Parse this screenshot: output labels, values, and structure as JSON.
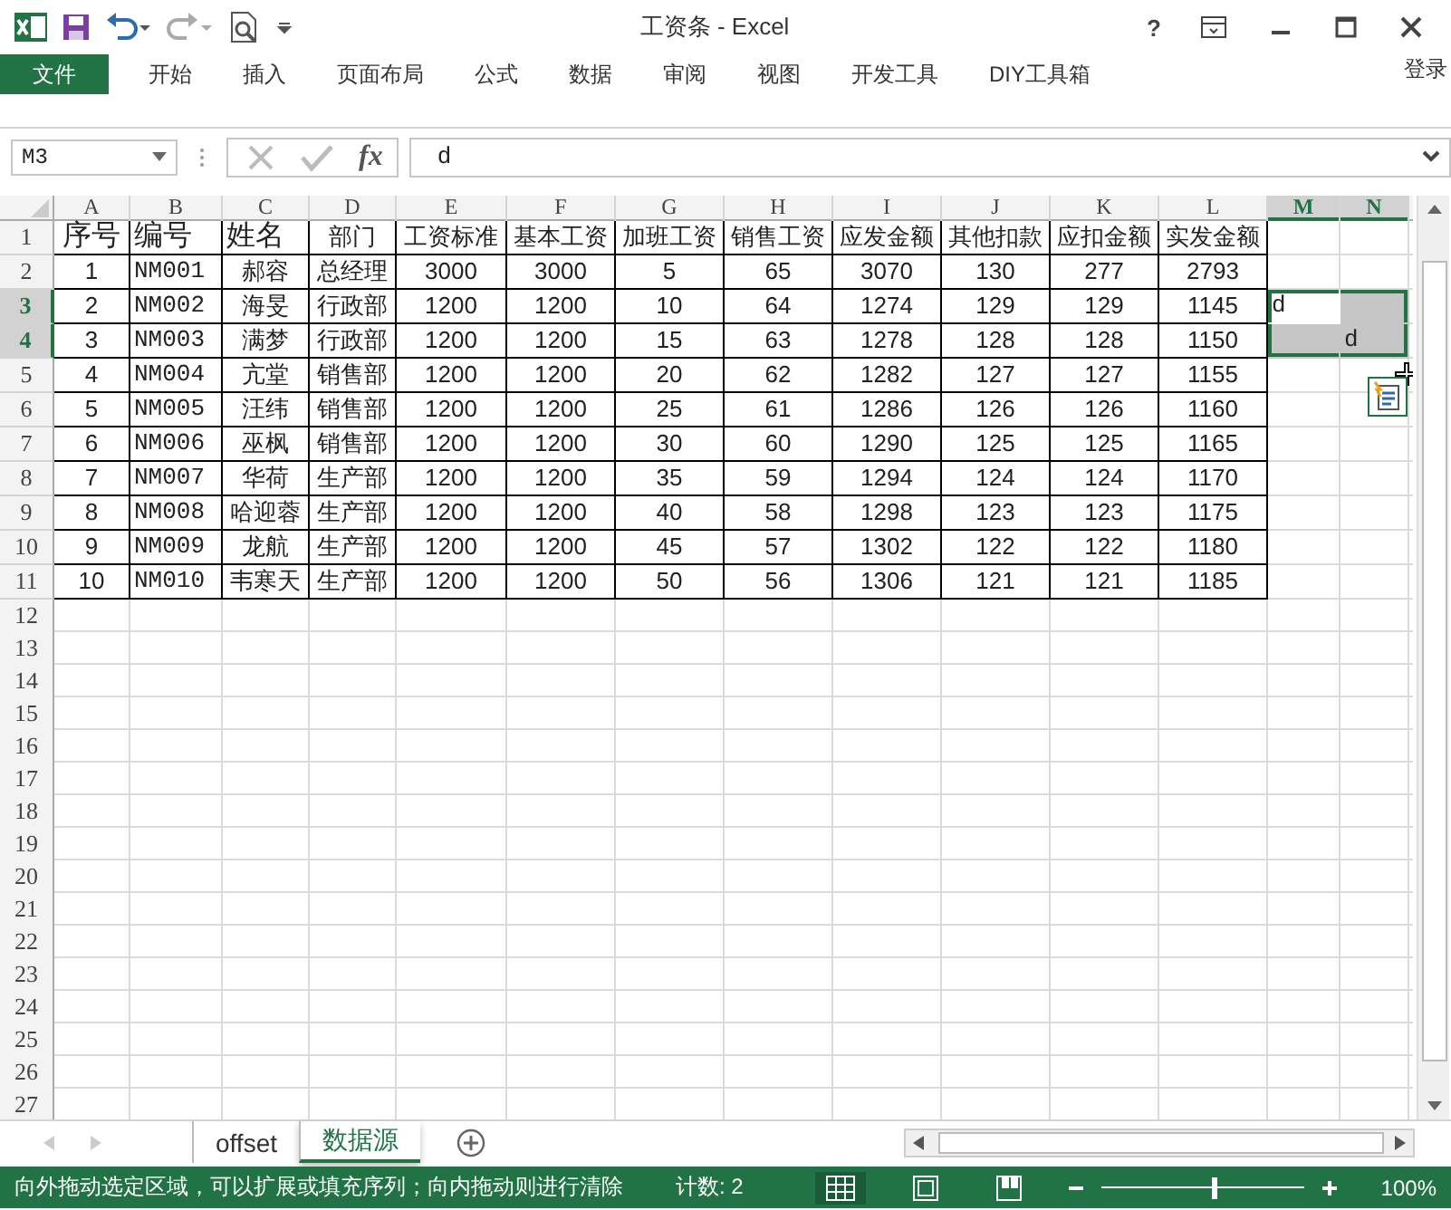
{
  "window": {
    "title": "工资条 - Excel",
    "help": "?"
  },
  "ribbon_tabs": [
    {
      "label": "文件",
      "selected": true
    },
    {
      "label": "开始",
      "selected": false
    },
    {
      "label": "插入",
      "selected": false
    },
    {
      "label": "页面布局",
      "selected": false
    },
    {
      "label": "公式",
      "selected": false
    },
    {
      "label": "数据",
      "selected": false
    },
    {
      "label": "审阅",
      "selected": false
    },
    {
      "label": "视图",
      "selected": false
    },
    {
      "label": "开发工具",
      "selected": false
    },
    {
      "label": "DIY工具箱",
      "selected": false
    }
  ],
  "sign_in": "登录",
  "formula_bar": {
    "name_box": "M3",
    "fx": "fx",
    "value": "d"
  },
  "columns": [
    {
      "label": "A",
      "selected": false
    },
    {
      "label": "B",
      "selected": false
    },
    {
      "label": "C",
      "selected": false
    },
    {
      "label": "D",
      "selected": false
    },
    {
      "label": "E",
      "selected": false
    },
    {
      "label": "F",
      "selected": false
    },
    {
      "label": "G",
      "selected": false
    },
    {
      "label": "H",
      "selected": false
    },
    {
      "label": "I",
      "selected": false
    },
    {
      "label": "J",
      "selected": false
    },
    {
      "label": "K",
      "selected": false
    },
    {
      "label": "L",
      "selected": false
    },
    {
      "label": "M",
      "selected": true
    },
    {
      "label": "N",
      "selected": true
    }
  ],
  "rows": [
    {
      "number": "1",
      "selected": false,
      "cells": [
        "序号",
        "编号",
        "姓名",
        "部门",
        "工资标准",
        "基本工资",
        "加班工资",
        "销售工资",
        "应发金额",
        "其他扣款",
        "应扣金额",
        "实发金额"
      ]
    },
    {
      "number": "2",
      "selected": false,
      "cells": [
        "1",
        "NM001",
        "郝容",
        "总经理",
        "3000",
        "3000",
        "5",
        "65",
        "3070",
        "130",
        "277",
        "2793"
      ]
    },
    {
      "number": "3",
      "selected": true,
      "cells": [
        "2",
        "NM002",
        "海旻",
        "行政部",
        "1200",
        "1200",
        "10",
        "64",
        "1274",
        "129",
        "129",
        "1145",
        "d",
        null
      ]
    },
    {
      "number": "4",
      "selected": true,
      "cells": [
        "3",
        "NM003",
        "满梦",
        "行政部",
        "1200",
        "1200",
        "15",
        "63",
        "1278",
        "128",
        "128",
        "1150",
        null,
        "d"
      ]
    },
    {
      "number": "5",
      "selected": false,
      "cells": [
        "4",
        "NM004",
        "亢堂",
        "销售部",
        "1200",
        "1200",
        "20",
        "62",
        "1282",
        "127",
        "127",
        "1155"
      ]
    },
    {
      "number": "6",
      "selected": false,
      "cells": [
        "5",
        "NM005",
        "汪纬",
        "销售部",
        "1200",
        "1200",
        "25",
        "61",
        "1286",
        "126",
        "126",
        "1160"
      ]
    },
    {
      "number": "7",
      "selected": false,
      "cells": [
        "6",
        "NM006",
        "巫枫",
        "销售部",
        "1200",
        "1200",
        "30",
        "60",
        "1290",
        "125",
        "125",
        "1165"
      ]
    },
    {
      "number": "8",
      "selected": false,
      "cells": [
        "7",
        "NM007",
        "华荷",
        "生产部",
        "1200",
        "1200",
        "35",
        "59",
        "1294",
        "124",
        "124",
        "1170"
      ]
    },
    {
      "number": "9",
      "selected": false,
      "cells": [
        "8",
        "NM008",
        "哈迎蓉",
        "生产部",
        "1200",
        "1200",
        "40",
        "58",
        "1298",
        "123",
        "123",
        "1175"
      ]
    },
    {
      "number": "10",
      "selected": false,
      "cells": [
        "9",
        "NM009",
        "龙航",
        "生产部",
        "1200",
        "1200",
        "45",
        "57",
        "1302",
        "122",
        "122",
        "1180"
      ]
    },
    {
      "number": "11",
      "selected": false,
      "cells": [
        "10",
        "NM010",
        "韦寒天",
        "生产部",
        "1200",
        "1200",
        "50",
        "56",
        "1306",
        "121",
        "121",
        "1185"
      ]
    },
    {
      "number": "12",
      "selected": false
    },
    {
      "number": "13",
      "selected": false
    },
    {
      "number": "14",
      "selected": false
    },
    {
      "number": "15",
      "selected": false
    },
    {
      "number": "16",
      "selected": false
    },
    {
      "number": "17",
      "selected": false
    },
    {
      "number": "18",
      "selected": false
    },
    {
      "number": "19",
      "selected": false
    },
    {
      "number": "20",
      "selected": false
    },
    {
      "number": "21",
      "selected": false
    },
    {
      "number": "22",
      "selected": false
    },
    {
      "number": "23",
      "selected": false
    },
    {
      "number": "24",
      "selected": false
    },
    {
      "number": "25",
      "selected": false
    },
    {
      "number": "26",
      "selected": false
    },
    {
      "number": "27",
      "selected": false
    }
  ],
  "sheet_tabs": [
    {
      "label": "offset",
      "selected": false
    },
    {
      "label": "数据源",
      "selected": true
    }
  ],
  "status_bar": {
    "message": "向外拖动选定区域，可以扩展或填充序列；向内拖动则进行清除",
    "count": "计数: 2",
    "views": [
      {
        "kind": "normal",
        "selected": true
      },
      {
        "kind": "page-layout",
        "selected": false
      },
      {
        "kind": "page-break",
        "selected": false
      }
    ],
    "zoom": {
      "level": 0.55,
      "reading": "100%"
    }
  }
}
